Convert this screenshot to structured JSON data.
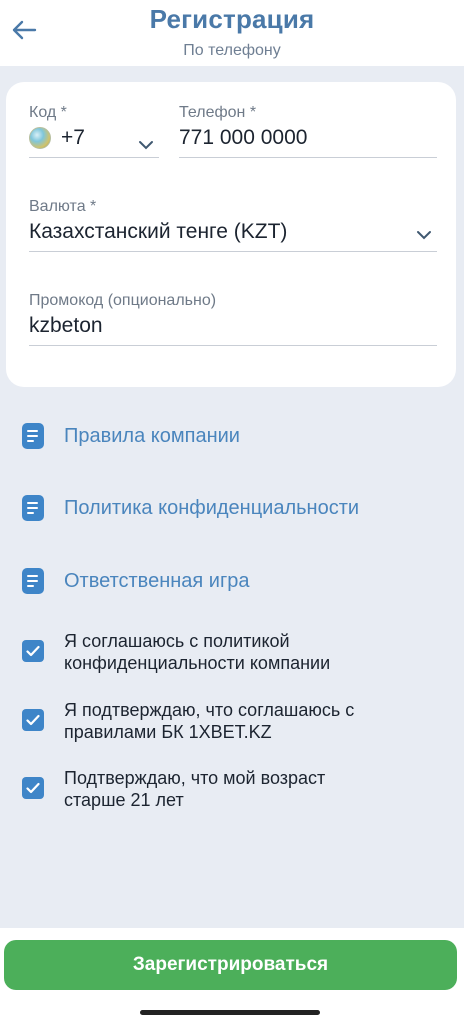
{
  "header": {
    "title": "Регистрация",
    "subtitle": "По телефону",
    "back_icon": "arrow-left-icon"
  },
  "form": {
    "code": {
      "label": "Код *",
      "value": "+7",
      "flag_icon": "kazakhstan-flag-icon"
    },
    "phone": {
      "label": "Телефон *",
      "value": "771 000 0000"
    },
    "currency": {
      "label": "Валюта *",
      "value": "Казахстанский тенге (KZT)"
    },
    "promo": {
      "label": "Промокод (опционально)",
      "value": "kzbeton"
    }
  },
  "links": [
    {
      "label": "Правила компании"
    },
    {
      "label": "Политика конфиденциальности"
    },
    {
      "label": "Ответственная игра"
    }
  ],
  "agreements": [
    {
      "line1": "Я соглашаюсь с политикой",
      "line2": "конфиденциальности компании",
      "checked": true
    },
    {
      "line1": "Я подтверждаю, что соглашаюсь с",
      "line2": "правилами БК 1XBET.KZ",
      "checked": true
    },
    {
      "line1": "Подтверждаю, что мой возраст",
      "line2": "старше 21 лет",
      "checked": true
    }
  ],
  "footer": {
    "register_label": "Зарегистрироваться"
  },
  "colors": {
    "accent": "#3e85c8",
    "title": "#4a79a8",
    "link": "#4a85bd",
    "button": "#4caf5a",
    "background": "#e8ecf3"
  }
}
